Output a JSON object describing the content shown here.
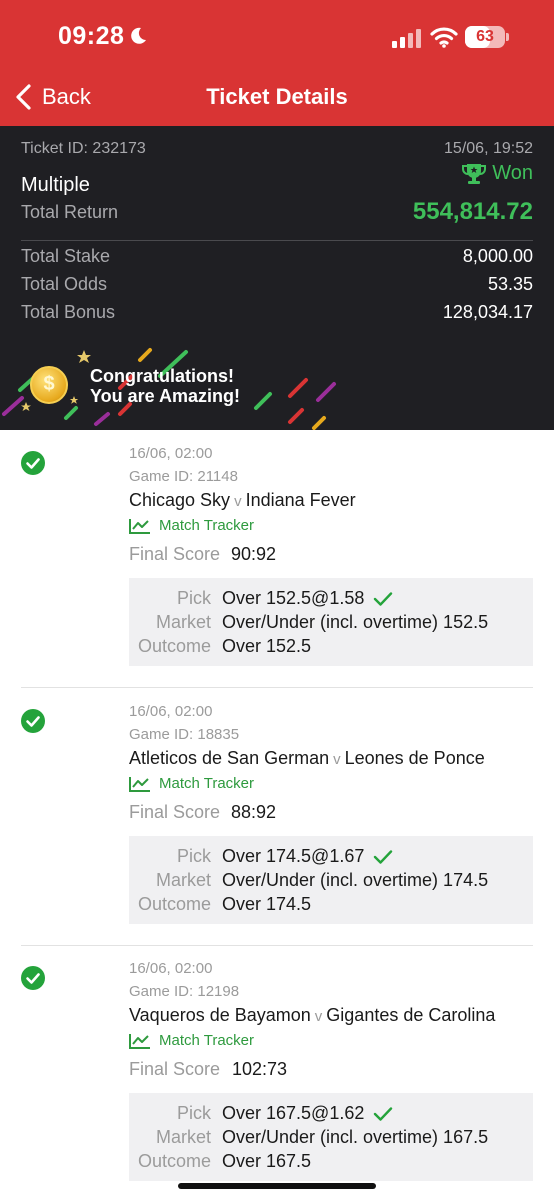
{
  "status_bar": {
    "time": "09:28",
    "battery": "63"
  },
  "nav": {
    "back_label": "Back",
    "title": "Ticket Details"
  },
  "ticket": {
    "id_label": "Ticket ID: 232173",
    "datetime": "15/06, 19:52",
    "type": "Multiple",
    "status": "Won",
    "total_return_label": "Total Return",
    "total_return": "554,814.72",
    "rows": [
      {
        "label": "Total Stake",
        "value": "8,000.00"
      },
      {
        "label": "Total Odds",
        "value": "53.35"
      },
      {
        "label": "Total Bonus",
        "value": "128,034.17"
      }
    ],
    "banner_line1": "Congratulations!",
    "banner_line2": "You are Amazing!",
    "coin_symbol": "$"
  },
  "labels": {
    "vs": "v",
    "match_tracker": "Match Tracker",
    "final_score": "Final Score",
    "pick": "Pick",
    "market": "Market",
    "outcome": "Outcome"
  },
  "bets": [
    {
      "kickoff": "16/06, 02:00",
      "game_id": "Game ID: 21148",
      "home": "Chicago Sky",
      "away": "Indiana Fever",
      "final_score": "90:92",
      "pick": "Over 152.5@1.58",
      "market": "Over/Under (incl. overtime) 152.5",
      "outcome": "Over 152.5"
    },
    {
      "kickoff": "16/06, 02:00",
      "game_id": "Game ID: 18835",
      "home": "Atleticos de San German",
      "away": "Leones de Ponce",
      "final_score": "88:92",
      "pick": "Over 174.5@1.67",
      "market": "Over/Under (incl. overtime) 174.5",
      "outcome": "Over 174.5"
    },
    {
      "kickoff": "16/06, 02:00",
      "game_id": "Game ID: 12198",
      "home": "Vaqueros de Bayamon",
      "away": "Gigantes de Carolina",
      "final_score": "102:73",
      "pick": "Over 167.5@1.62",
      "market": "Over/Under (incl. overtime) 167.5",
      "outcome": "Over 167.5"
    }
  ],
  "colors": {
    "header_red": "#d93434",
    "panel_dark": "#1f1f23",
    "won_green": "#3fbf5a",
    "tracker_green": "#2e9a3e",
    "check_green": "#24a33b"
  },
  "icons": [
    "moon-icon",
    "signal-icon",
    "wifi-icon",
    "battery-icon",
    "chevron-left-icon",
    "trophy-icon",
    "coin-icon",
    "check-circle-icon",
    "tracker-chart-icon",
    "checkmark-icon"
  ]
}
